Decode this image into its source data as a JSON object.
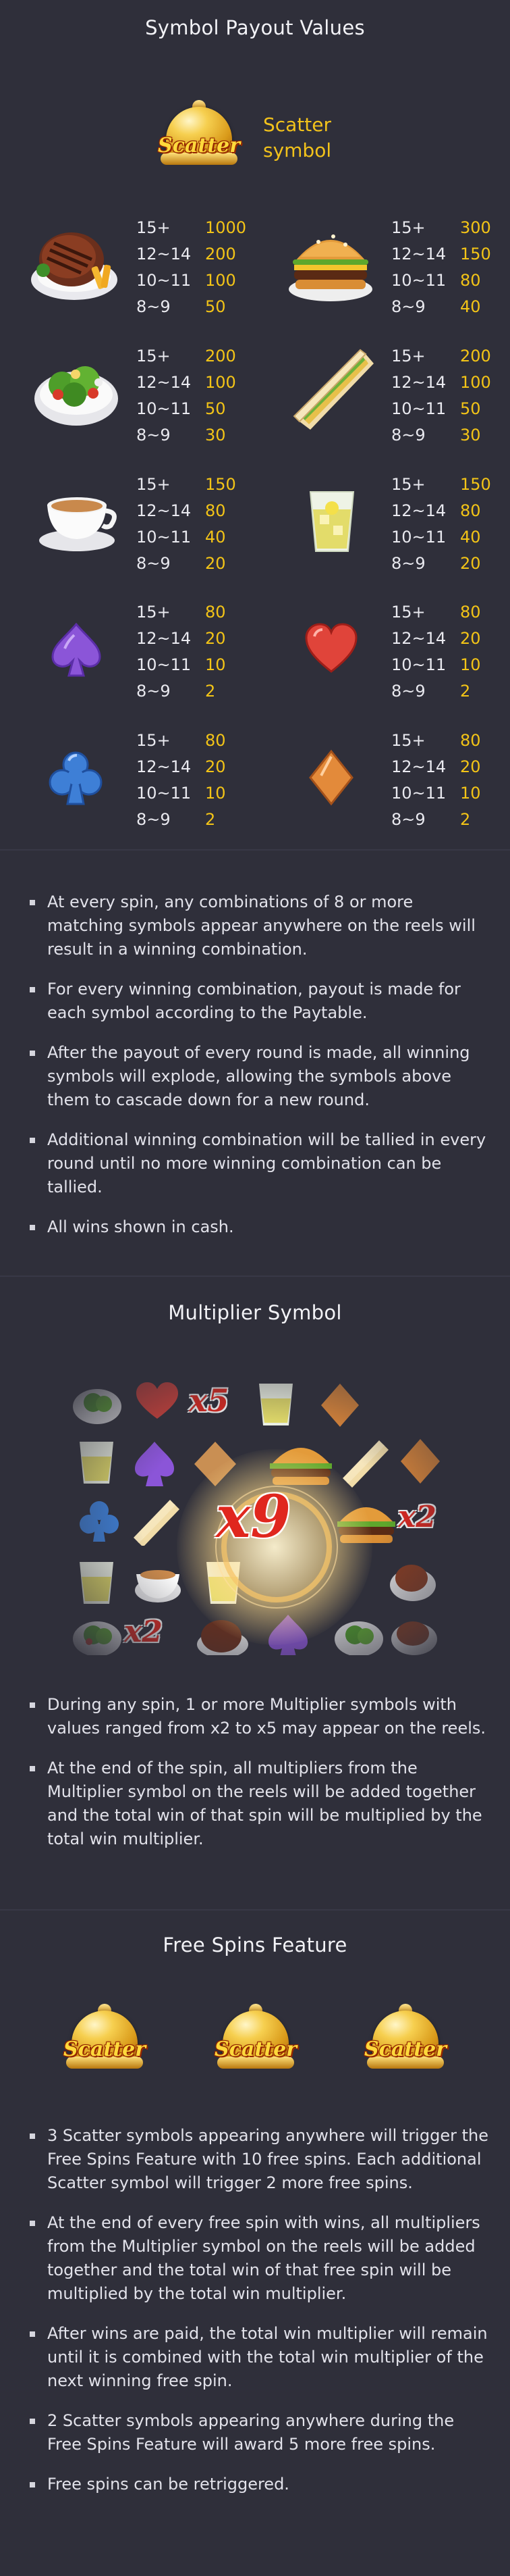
{
  "payout": {
    "title": "Symbol Payout Values",
    "scatter_icon_text": "Scatter",
    "scatter_label_line1": "Scatter",
    "scatter_label_line2": "symbol",
    "symbols": [
      {
        "icon": "steak-icon",
        "rows": [
          [
            "15+",
            "1000"
          ],
          [
            "12~14",
            "200"
          ],
          [
            "10~11",
            "100"
          ],
          [
            "8~9",
            "50"
          ]
        ]
      },
      {
        "icon": "burger-icon",
        "rows": [
          [
            "15+",
            "300"
          ],
          [
            "12~14",
            "150"
          ],
          [
            "10~11",
            "80"
          ],
          [
            "8~9",
            "40"
          ]
        ]
      },
      {
        "icon": "salad-icon",
        "rows": [
          [
            "15+",
            "200"
          ],
          [
            "12~14",
            "100"
          ],
          [
            "10~11",
            "50"
          ],
          [
            "8~9",
            "30"
          ]
        ]
      },
      {
        "icon": "sandwich-icon",
        "rows": [
          [
            "15+",
            "200"
          ],
          [
            "12~14",
            "100"
          ],
          [
            "10~11",
            "50"
          ],
          [
            "8~9",
            "30"
          ]
        ]
      },
      {
        "icon": "coffee-cup-icon",
        "rows": [
          [
            "15+",
            "150"
          ],
          [
            "12~14",
            "80"
          ],
          [
            "10~11",
            "40"
          ],
          [
            "8~9",
            "20"
          ]
        ]
      },
      {
        "icon": "lemonade-glass-icon",
        "rows": [
          [
            "15+",
            "150"
          ],
          [
            "12~14",
            "80"
          ],
          [
            "10~11",
            "40"
          ],
          [
            "8~9",
            "20"
          ]
        ]
      },
      {
        "icon": "spade-icon",
        "rows": [
          [
            "15+",
            "80"
          ],
          [
            "12~14",
            "20"
          ],
          [
            "10~11",
            "10"
          ],
          [
            "8~9",
            "2"
          ]
        ]
      },
      {
        "icon": "heart-icon",
        "rows": [
          [
            "15+",
            "80"
          ],
          [
            "12~14",
            "20"
          ],
          [
            "10~11",
            "10"
          ],
          [
            "8~9",
            "2"
          ]
        ]
      },
      {
        "icon": "club-icon",
        "rows": [
          [
            "15+",
            "80"
          ],
          [
            "12~14",
            "20"
          ],
          [
            "10~11",
            "10"
          ],
          [
            "8~9",
            "2"
          ]
        ]
      },
      {
        "icon": "diamond-icon",
        "rows": [
          [
            "15+",
            "80"
          ],
          [
            "12~14",
            "20"
          ],
          [
            "10~11",
            "10"
          ],
          [
            "8~9",
            "2"
          ]
        ]
      }
    ],
    "bullets": [
      "At every spin, any combinations of 8 or more matching symbols appear anywhere on the reels will result in a winning combination.",
      "For every winning combination, payout is made for each symbol according to the Paytable.",
      "After the payout of every round is made, all winning symbols will explode, allowing the symbols above them to cascade down for a new round.",
      "Additional winning combination will be tallied in every round until no more winning combination can be tallied.",
      "All wins shown in cash."
    ]
  },
  "multiplier": {
    "title": "Multiplier Symbol",
    "center_value": "x9",
    "side_values": [
      "x5",
      "x2",
      "x2"
    ],
    "bullets": [
      "During any spin, 1 or more Multiplier symbols with values ranged from x2 to x5 may appear on the reels.",
      "At the end of the spin, all multipliers from the Multiplier symbol on the reels will be added together and the total win of that spin will be multiplied by the total win multiplier."
    ]
  },
  "free_spins": {
    "title": "Free Spins Feature",
    "scatter_icon_text": "Scatter",
    "bullets": [
      "3 Scatter symbols appearing anywhere will trigger the Free Spins Feature with 10 free spins. Each additional Scatter symbol will trigger 2 more free spins.",
      "At the end of every free spin with wins, all multipliers from the Multiplier symbol on the reels will be added together and the total win of that free spin will be multiplied by the total win multiplier.",
      "After wins are paid, the total win multiplier will remain until it is combined with the total win multiplier of the next winning free spin.",
      "2 Scatter symbols appearing anywhere during the Free Spins Feature will award 5 more free spins.",
      "Free spins can be retriggered."
    ]
  },
  "colors": {
    "background": "#2f2f3a",
    "payout_value": "#f3c417",
    "scatter_label": "#f2c21b"
  }
}
